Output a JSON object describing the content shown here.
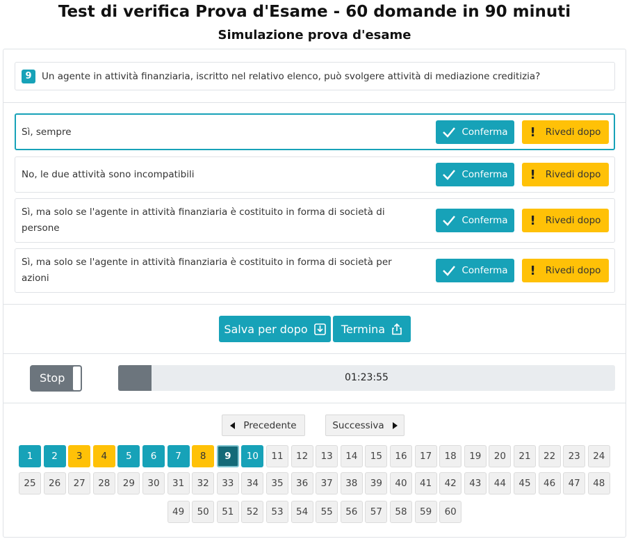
{
  "header": {
    "title": "Test di verifica Prova d'Esame - 60 domande in 90 minuti",
    "subtitle": "Simulazione prova d'esame"
  },
  "question": {
    "number": "9",
    "text": "Un agente in attività finanziaria, iscritto nel relativo elenco, può svolgere attività di mediazione creditizia?"
  },
  "answers": [
    {
      "text": "Sì, sempre",
      "confirm_label": "Conferma",
      "review_label": "Rivedi dopo"
    },
    {
      "text": "No, le due attività sono incompatibili",
      "confirm_label": "Conferma",
      "review_label": "Rivedi dopo"
    },
    {
      "text": "Sì, ma solo se l'agente in attività finanziaria è costituito in forma di società di persone",
      "confirm_label": "Conferma",
      "review_label": "Rivedi dopo"
    },
    {
      "text": "Sì, ma solo se l'agente in attività finanziaria è costituito in forma di società per azioni",
      "confirm_label": "Conferma",
      "review_label": "Rivedi dopo"
    }
  ],
  "actions": {
    "save_label": "Salva per dopo",
    "finish_label": "Termina"
  },
  "timer": {
    "stop_label": "Stop",
    "time": "01:23:55",
    "elapsed_fraction": 0.067
  },
  "navigation": {
    "prev_label": "Precedente",
    "next_label": "Successiva",
    "questions": [
      {
        "n": "1",
        "state": "answered"
      },
      {
        "n": "2",
        "state": "answered"
      },
      {
        "n": "3",
        "state": "review"
      },
      {
        "n": "4",
        "state": "review"
      },
      {
        "n": "5",
        "state": "answered"
      },
      {
        "n": "6",
        "state": "answered"
      },
      {
        "n": "7",
        "state": "answered"
      },
      {
        "n": "8",
        "state": "review"
      },
      {
        "n": "9",
        "state": "current"
      },
      {
        "n": "10",
        "state": "answered"
      },
      {
        "n": "11",
        "state": "empty"
      },
      {
        "n": "12",
        "state": "empty"
      },
      {
        "n": "13",
        "state": "empty"
      },
      {
        "n": "14",
        "state": "empty"
      },
      {
        "n": "15",
        "state": "empty"
      },
      {
        "n": "16",
        "state": "empty"
      },
      {
        "n": "17",
        "state": "empty"
      },
      {
        "n": "18",
        "state": "empty"
      },
      {
        "n": "19",
        "state": "empty"
      },
      {
        "n": "20",
        "state": "empty"
      },
      {
        "n": "21",
        "state": "empty"
      },
      {
        "n": "22",
        "state": "empty"
      },
      {
        "n": "23",
        "state": "empty"
      },
      {
        "n": "24",
        "state": "empty"
      },
      {
        "n": "25",
        "state": "empty"
      },
      {
        "n": "26",
        "state": "empty"
      },
      {
        "n": "27",
        "state": "empty"
      },
      {
        "n": "28",
        "state": "empty"
      },
      {
        "n": "29",
        "state": "empty"
      },
      {
        "n": "30",
        "state": "empty"
      },
      {
        "n": "31",
        "state": "empty"
      },
      {
        "n": "32",
        "state": "empty"
      },
      {
        "n": "33",
        "state": "empty"
      },
      {
        "n": "34",
        "state": "empty"
      },
      {
        "n": "35",
        "state": "empty"
      },
      {
        "n": "36",
        "state": "empty"
      },
      {
        "n": "37",
        "state": "empty"
      },
      {
        "n": "38",
        "state": "empty"
      },
      {
        "n": "39",
        "state": "empty"
      },
      {
        "n": "40",
        "state": "empty"
      },
      {
        "n": "41",
        "state": "empty"
      },
      {
        "n": "42",
        "state": "empty"
      },
      {
        "n": "43",
        "state": "empty"
      },
      {
        "n": "44",
        "state": "empty"
      },
      {
        "n": "45",
        "state": "empty"
      },
      {
        "n": "46",
        "state": "empty"
      },
      {
        "n": "47",
        "state": "empty"
      },
      {
        "n": "48",
        "state": "empty"
      },
      {
        "n": "49",
        "state": "empty"
      },
      {
        "n": "50",
        "state": "empty"
      },
      {
        "n": "51",
        "state": "empty"
      },
      {
        "n": "52",
        "state": "empty"
      },
      {
        "n": "53",
        "state": "empty"
      },
      {
        "n": "54",
        "state": "empty"
      },
      {
        "n": "55",
        "state": "empty"
      },
      {
        "n": "56",
        "state": "empty"
      },
      {
        "n": "57",
        "state": "empty"
      },
      {
        "n": "58",
        "state": "empty"
      },
      {
        "n": "59",
        "state": "empty"
      },
      {
        "n": "60",
        "state": "empty"
      }
    ]
  },
  "colors": {
    "primary": "#17a2b8",
    "warning": "#ffc107",
    "current": "#146a78",
    "secondary": "#6c757d"
  }
}
